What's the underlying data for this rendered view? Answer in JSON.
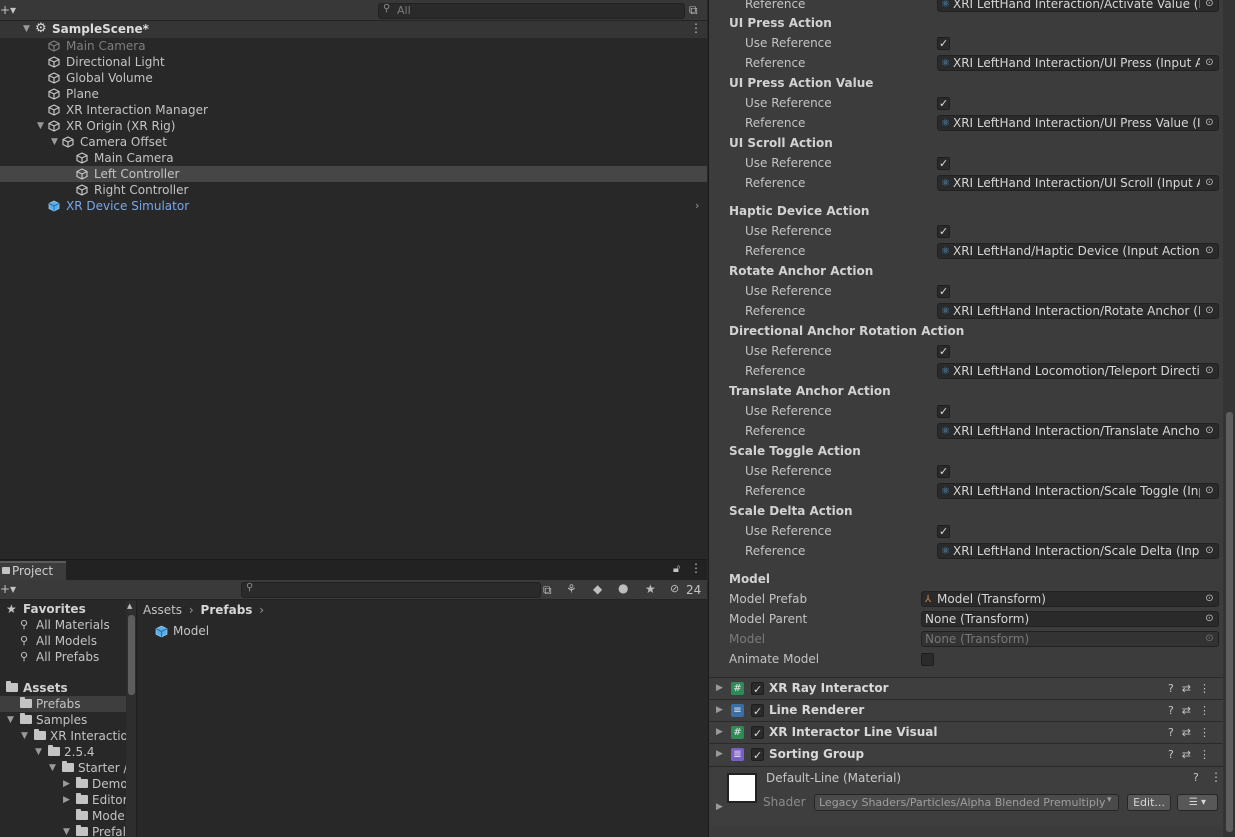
{
  "hierarchy": {
    "search_placeholder": "All",
    "scene_name": "SampleScene*",
    "items": [
      {
        "label": "Main Camera"
      },
      {
        "label": "Directional Light"
      },
      {
        "label": "Global Volume"
      },
      {
        "label": "Plane"
      },
      {
        "label": "XR Interaction Manager"
      },
      {
        "label": "XR Origin (XR Rig)"
      },
      {
        "label": "Camera Offset"
      },
      {
        "label": "Main Camera"
      },
      {
        "label": "Left Controller"
      },
      {
        "label": "Right Controller"
      },
      {
        "label": "XR Device Simulator"
      }
    ]
  },
  "project": {
    "tab_label": "Project",
    "hidden_count": "24",
    "favorites_label": "Favorites",
    "favorites": [
      "All Materials",
      "All Models",
      "All Prefabs"
    ],
    "assets_label": "Assets",
    "tree": [
      "Prefabs",
      "Samples",
      "XR Interaction",
      "2.5.4",
      "Starter /",
      "Demo",
      "Editor",
      "Mode",
      "Prefal"
    ],
    "breadcrumb": [
      "Assets",
      "Prefabs"
    ],
    "content_items": [
      "Model"
    ]
  },
  "inspector": {
    "top_reference_label": "Reference",
    "top_reference_value": "XRI LeftHand Interaction/Activate Value (Input Action Reference)",
    "use_reference_label": "Use Reference",
    "reference_label": "Reference",
    "actions": [
      {
        "header": "UI Press Action",
        "ref": "XRI LeftHand Interaction/UI Press (Input Action Reference)"
      },
      {
        "header": "UI Press Action Value",
        "ref": "XRI LeftHand Interaction/UI Press Value (Input Action Reference)"
      },
      {
        "header": "UI Scroll Action",
        "ref": "XRI LeftHand Interaction/UI Scroll (Input Action Reference)"
      },
      {
        "header": "Haptic Device Action",
        "ref": "XRI LeftHand/Haptic Device (Input Action Reference)"
      },
      {
        "header": "Rotate Anchor Action",
        "ref": "XRI LeftHand Interaction/Rotate Anchor (Input Action Reference)"
      },
      {
        "header": "Directional Anchor Rotation Action",
        "ref": "XRI LeftHand Locomotion/Teleport Direction (Input Action Reference)"
      },
      {
        "header": "Translate Anchor Action",
        "ref": "XRI LeftHand Interaction/Translate Anchor (Input Action Reference)"
      },
      {
        "header": "Scale Toggle Action",
        "ref": "XRI LeftHand Interaction/Scale Toggle (Input Action Reference)"
      },
      {
        "header": "Scale Delta Action",
        "ref": "XRI LeftHand Interaction/Scale Delta (Input Action Reference)"
      }
    ],
    "model": {
      "header": "Model",
      "prefab_label": "Model Prefab",
      "prefab_value": "Model (Transform)",
      "parent_label": "Model Parent",
      "parent_value": "None (Transform)",
      "model_label": "Model",
      "model_value": "None (Transform)",
      "animate_label": "Animate Model"
    },
    "components": [
      {
        "name": "XR Ray Interactor",
        "icon": "#",
        "icon_color": "#2e8b57"
      },
      {
        "name": "Line Renderer",
        "icon": "≡",
        "icon_color": "#3a6ea5"
      },
      {
        "name": "XR Interactor Line Visual",
        "icon": "#",
        "icon_color": "#2e8b57"
      },
      {
        "name": "Sorting Group",
        "icon": "≣",
        "icon_color": "#7b5fc7"
      }
    ],
    "material": {
      "name": "Default-Line (Material)",
      "shader_label": "Shader",
      "shader_value": "Legacy Shaders/Particles/Alpha Blended Premultiply",
      "edit_label": "Edit..."
    }
  }
}
